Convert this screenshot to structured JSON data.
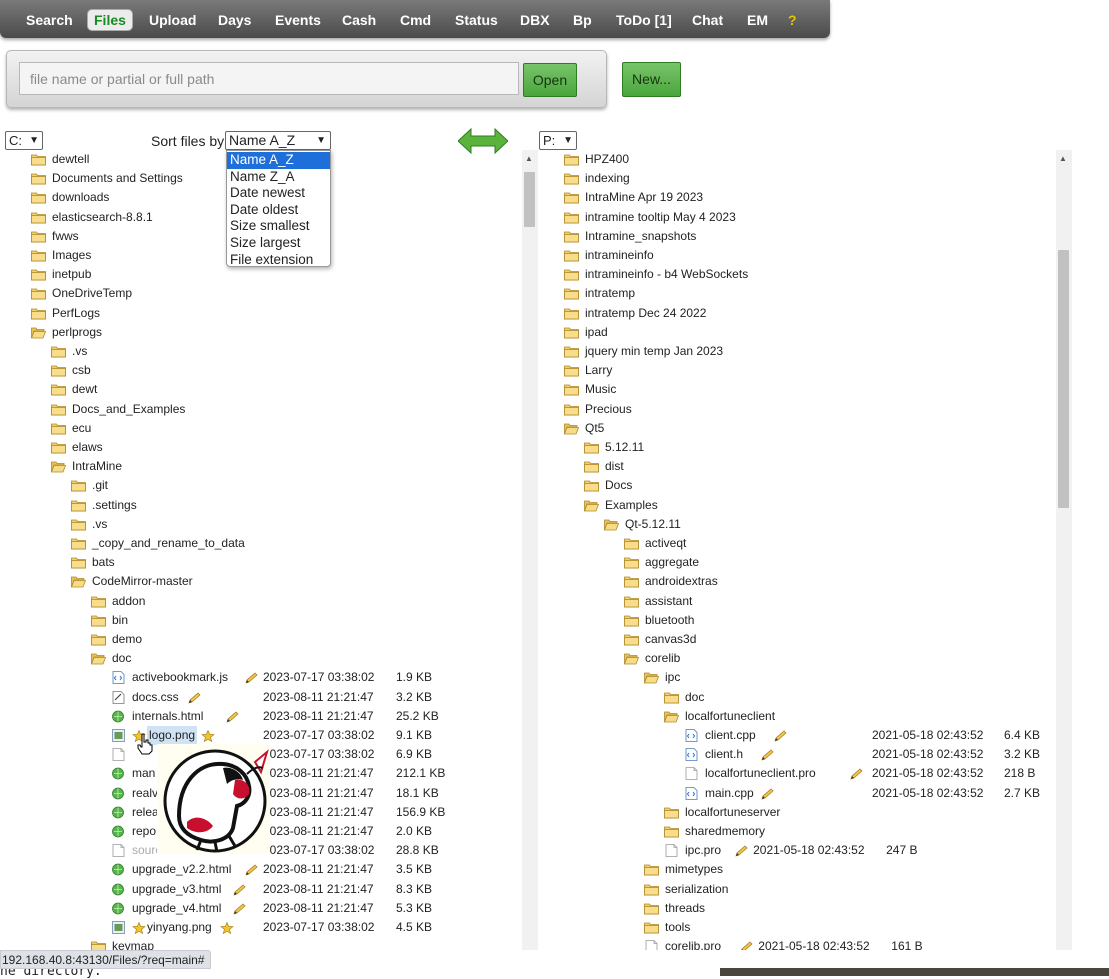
{
  "nav": {
    "tabs": [
      "Search",
      "Files",
      "Upload",
      "Days",
      "Events",
      "Cash",
      "Cmd",
      "Status",
      "DBX",
      "Bp",
      "ToDo [1]",
      "Chat",
      "EM"
    ],
    "active": "Files",
    "help_label": "?"
  },
  "open_panel": {
    "placeholder": "file name or partial or full path",
    "open_label": "Open"
  },
  "new_label": "New...",
  "left_drive": "C:",
  "right_drive": "P:",
  "sort": {
    "label": "Sort files by:",
    "selected": "Name A_Z",
    "options": [
      "Name A_Z",
      "Name Z_A",
      "Date newest",
      "Date oldest",
      "Size smallest",
      "Size largest",
      "File extension"
    ]
  },
  "left_tree": [
    {
      "name": "dewtell",
      "level": 0,
      "type": "folder"
    },
    {
      "name": "Documents and Settings",
      "level": 0,
      "type": "folder"
    },
    {
      "name": "downloads",
      "level": 0,
      "type": "folder"
    },
    {
      "name": "elasticsearch-8.8.1",
      "level": 0,
      "type": "folder"
    },
    {
      "name": "fwws",
      "level": 0,
      "type": "folder"
    },
    {
      "name": "Images",
      "level": 0,
      "type": "folder"
    },
    {
      "name": "inetpub",
      "level": 0,
      "type": "folder"
    },
    {
      "name": "OneDriveTemp",
      "level": 0,
      "type": "folder"
    },
    {
      "name": "PerfLogs",
      "level": 0,
      "type": "folder"
    },
    {
      "name": "perlprogs",
      "level": 0,
      "type": "folder-open"
    },
    {
      "name": ".vs",
      "level": 1,
      "type": "folder"
    },
    {
      "name": "csb",
      "level": 1,
      "type": "folder"
    },
    {
      "name": "dewt",
      "level": 1,
      "type": "folder"
    },
    {
      "name": "Docs_and_Examples",
      "level": 1,
      "type": "folder"
    },
    {
      "name": "ecu",
      "level": 1,
      "type": "folder"
    },
    {
      "name": "elaws",
      "level": 1,
      "type": "folder"
    },
    {
      "name": "IntraMine",
      "level": 1,
      "type": "folder-open"
    },
    {
      "name": ".git",
      "level": 2,
      "type": "folder"
    },
    {
      "name": ".settings",
      "level": 2,
      "type": "folder"
    },
    {
      "name": ".vs",
      "level": 2,
      "type": "folder"
    },
    {
      "name": "_copy_and_rename_to_data",
      "level": 2,
      "type": "folder"
    },
    {
      "name": "bats",
      "level": 2,
      "type": "folder"
    },
    {
      "name": "CodeMirror-master",
      "level": 2,
      "type": "folder-open"
    },
    {
      "name": "addon",
      "level": 3,
      "type": "folder"
    },
    {
      "name": "bin",
      "level": 3,
      "type": "folder"
    },
    {
      "name": "demo",
      "level": 3,
      "type": "folder"
    },
    {
      "name": "doc",
      "level": 3,
      "type": "folder-open"
    },
    {
      "name": "activebookmark.js",
      "level": 4,
      "type": "js",
      "pencil": true,
      "date": "2023-07-17 03:38:02",
      "size": "1.9 KB"
    },
    {
      "name": "docs.css",
      "level": 4,
      "type": "css",
      "pencil": true,
      "date": "2023-08-11 21:21:47",
      "size": "3.2 KB"
    },
    {
      "name": "internals.html",
      "level": 4,
      "type": "html",
      "pencil": true,
      "date": "2023-08-11 21:21:47",
      "size": "25.2 KB"
    },
    {
      "name": "logo.png",
      "level": 4,
      "type": "image",
      "star": true,
      "hover": true,
      "date": "2023-07-17 03:38:02",
      "size": "9.1 KB"
    },
    {
      "name": "",
      "level": 4,
      "type": "file",
      "date": "2023-07-17 03:38:02",
      "size": "6.9 KB"
    },
    {
      "name": "man",
      "level": 4,
      "type": "html",
      "date": "2023-08-11 21:21:47",
      "size": "212.1 KB"
    },
    {
      "name": "realv",
      "level": 4,
      "type": "html",
      "date": "2023-08-11 21:21:47",
      "size": "18.1 KB"
    },
    {
      "name": "relea",
      "level": 4,
      "type": "html",
      "date": "2023-08-11 21:21:47",
      "size": "156.9 KB"
    },
    {
      "name": "repo",
      "level": 4,
      "type": "html",
      "date": "2023-08-11 21:21:47",
      "size": "2.0 KB"
    },
    {
      "name": "sourc",
      "level": 4,
      "type": "file",
      "dim": true,
      "date": "2023-07-17 03:38:02",
      "size": "28.8 KB"
    },
    {
      "name": "upgrade_v2.2.html",
      "level": 4,
      "type": "html",
      "pencil": true,
      "date": "2023-08-11 21:21:47",
      "size": "3.5 KB"
    },
    {
      "name": "upgrade_v3.html",
      "level": 4,
      "type": "html",
      "pencil": true,
      "date": "2023-08-11 21:21:47",
      "size": "8.3 KB"
    },
    {
      "name": "upgrade_v4.html",
      "level": 4,
      "type": "html",
      "pencil": true,
      "date": "2023-08-11 21:21:47",
      "size": "5.3 KB"
    },
    {
      "name": "yinyang.png",
      "level": 4,
      "type": "image",
      "star": true,
      "date": "2023-07-17 03:38:02",
      "size": "4.5 KB"
    },
    {
      "name": "keymap",
      "level": 3,
      "type": "folder"
    }
  ],
  "right_tree": [
    {
      "name": "HPZ400",
      "level": 0,
      "type": "folder"
    },
    {
      "name": "indexing",
      "level": 0,
      "type": "folder"
    },
    {
      "name": "IntraMine Apr 19 2023",
      "level": 0,
      "type": "folder"
    },
    {
      "name": "intramine tooltip May 4 2023",
      "level": 0,
      "type": "folder"
    },
    {
      "name": "Intramine_snapshots",
      "level": 0,
      "type": "folder"
    },
    {
      "name": "intramineinfo",
      "level": 0,
      "type": "folder"
    },
    {
      "name": "intramineinfo - b4 WebSockets",
      "level": 0,
      "type": "folder"
    },
    {
      "name": "intratemp",
      "level": 0,
      "type": "folder"
    },
    {
      "name": "intratemp Dec 24 2022",
      "level": 0,
      "type": "folder"
    },
    {
      "name": "ipad",
      "level": 0,
      "type": "folder"
    },
    {
      "name": "jquery min temp Jan 2023",
      "level": 0,
      "type": "folder"
    },
    {
      "name": "Larry",
      "level": 0,
      "type": "folder"
    },
    {
      "name": "Music",
      "level": 0,
      "type": "folder"
    },
    {
      "name": "Precious",
      "level": 0,
      "type": "folder"
    },
    {
      "name": "Qt5",
      "level": 0,
      "type": "folder-open"
    },
    {
      "name": "5.12.11",
      "level": 1,
      "type": "folder"
    },
    {
      "name": "dist",
      "level": 1,
      "type": "folder"
    },
    {
      "name": "Docs",
      "level": 1,
      "type": "folder"
    },
    {
      "name": "Examples",
      "level": 1,
      "type": "folder-open"
    },
    {
      "name": "Qt-5.12.11",
      "level": 2,
      "type": "folder-open"
    },
    {
      "name": "activeqt",
      "level": 3,
      "type": "folder"
    },
    {
      "name": "aggregate",
      "level": 3,
      "type": "folder"
    },
    {
      "name": "androidextras",
      "level": 3,
      "type": "folder"
    },
    {
      "name": "assistant",
      "level": 3,
      "type": "folder"
    },
    {
      "name": "bluetooth",
      "level": 3,
      "type": "folder"
    },
    {
      "name": "canvas3d",
      "level": 3,
      "type": "folder"
    },
    {
      "name": "corelib",
      "level": 3,
      "type": "folder-open"
    },
    {
      "name": "ipc",
      "level": 4,
      "type": "folder-open"
    },
    {
      "name": "doc",
      "level": 5,
      "type": "folder"
    },
    {
      "name": "localfortuneclient",
      "level": 5,
      "type": "folder-open"
    },
    {
      "name": "client.cpp",
      "level": 6,
      "type": "cpp",
      "pencil": true,
      "date": "2021-05-18 02:43:52",
      "size": "6.4 KB"
    },
    {
      "name": "client.h",
      "level": 6,
      "type": "cpp",
      "pencil": true,
      "date": "2021-05-18 02:43:52",
      "size": "3.2 KB"
    },
    {
      "name": "localfortuneclient.pro",
      "level": 6,
      "type": "file",
      "pencil": true,
      "date": "2021-05-18 02:43:52",
      "size": "218 B"
    },
    {
      "name": "main.cpp",
      "level": 6,
      "type": "cpp",
      "pencil": true,
      "date": "2021-05-18 02:43:52",
      "size": "2.7 KB"
    },
    {
      "name": "localfortuneserver",
      "level": 5,
      "type": "folder"
    },
    {
      "name": "sharedmemory",
      "level": 5,
      "type": "folder"
    },
    {
      "name": "ipc.pro",
      "level": 5,
      "type": "file",
      "pencil": true,
      "date": "2021-05-18 02:43:52",
      "size": "247 B",
      "inline": true
    },
    {
      "name": "mimetypes",
      "level": 4,
      "type": "folder"
    },
    {
      "name": "serialization",
      "level": 4,
      "type": "folder"
    },
    {
      "name": "threads",
      "level": 4,
      "type": "folder"
    },
    {
      "name": "tools",
      "level": 4,
      "type": "folder"
    },
    {
      "name": "corelib.pro",
      "level": 4,
      "type": "file",
      "pencil": true,
      "date": "2021-05-18 02:43:52",
      "size": "161 B",
      "inline": true
    }
  ],
  "status_url": "192.168.40.8:43130/Files/?req=main#",
  "bottom_text": "he directory.",
  "colors": {
    "accent_green": "#4aa63c",
    "nav_bg": "#5a5a5a",
    "folder": "#f2cf6a",
    "selection": "#1e6fd9"
  }
}
